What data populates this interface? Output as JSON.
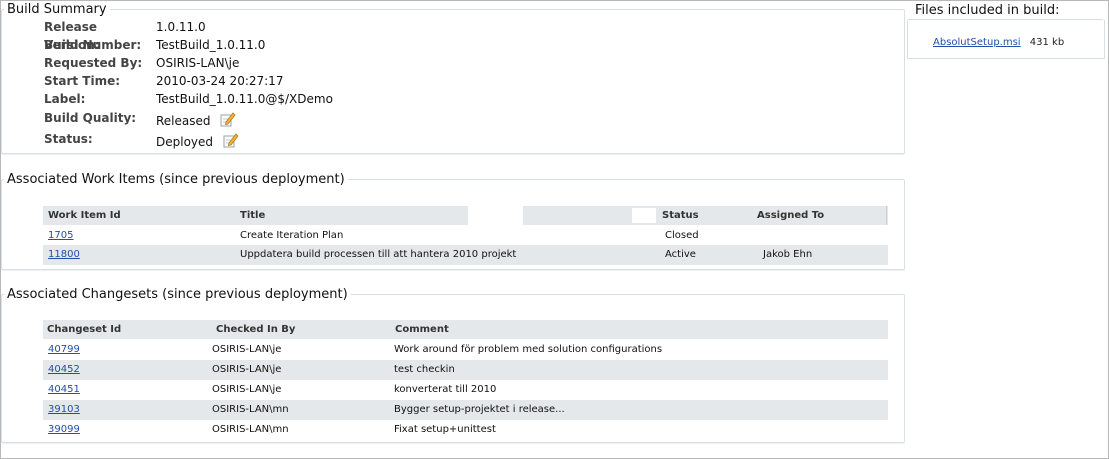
{
  "summary": {
    "title": "Build Summary",
    "rows": [
      {
        "label": "Release Version:",
        "value": "1.0.11.0"
      },
      {
        "label": "Build Number:",
        "value": "TestBuild_1.0.11.0"
      },
      {
        "label": "Requested By:",
        "value": "OSIRIS-LAN\\je"
      },
      {
        "label": "Start Time:",
        "value": "2010-03-24 20:27:17"
      },
      {
        "label": "Label:",
        "value": "TestBuild_1.0.11.0@$/XDemo"
      },
      {
        "label": "Build Quality:",
        "value": "Released"
      },
      {
        "label": "Status:",
        "value": "Deployed"
      }
    ],
    "edit_icon": "pencil-edit-icon"
  },
  "files": {
    "title": "Files included in build:",
    "items": [
      {
        "name": "AbsolutSetup.msi",
        "size": "431 kb"
      }
    ]
  },
  "work_items": {
    "title": "Associated Work Items (since previous deployment)",
    "columns": {
      "id": "Work Item Id",
      "title": "Title",
      "status": "Status",
      "assigned": "Assigned To"
    },
    "rows": [
      {
        "id": "1705",
        "title": "Create Iteration Plan",
        "status": "Closed",
        "assigned": ""
      },
      {
        "id": "11800",
        "title": "Uppdatera build processen till att hantera 2010 projekt",
        "status": "Active",
        "assigned": "Jakob Ehn"
      }
    ]
  },
  "changesets": {
    "title": "Associated Changesets (since previous deployment)",
    "columns": {
      "id": "Changeset Id",
      "by": "Checked In By",
      "comment": "Comment"
    },
    "rows": [
      {
        "id": "40799",
        "by": "OSIRIS-LAN\\je",
        "comment": "Work around för problem med solution configurations"
      },
      {
        "id": "40452",
        "by": "OSIRIS-LAN\\je",
        "comment": "test checkin"
      },
      {
        "id": "40451",
        "by": "OSIRIS-LAN\\je",
        "comment": "konverterat till 2010"
      },
      {
        "id": "39103",
        "by": "OSIRIS-LAN\\mn",
        "comment": "Bygger setup-projektet i release..."
      },
      {
        "id": "39099",
        "by": "OSIRIS-LAN\\mn",
        "comment": "Fixat setup+unittest"
      }
    ]
  },
  "colors": {
    "link": "#1f4fa8",
    "header_bg": "#e4e8ea",
    "border": "#dadfe3"
  }
}
